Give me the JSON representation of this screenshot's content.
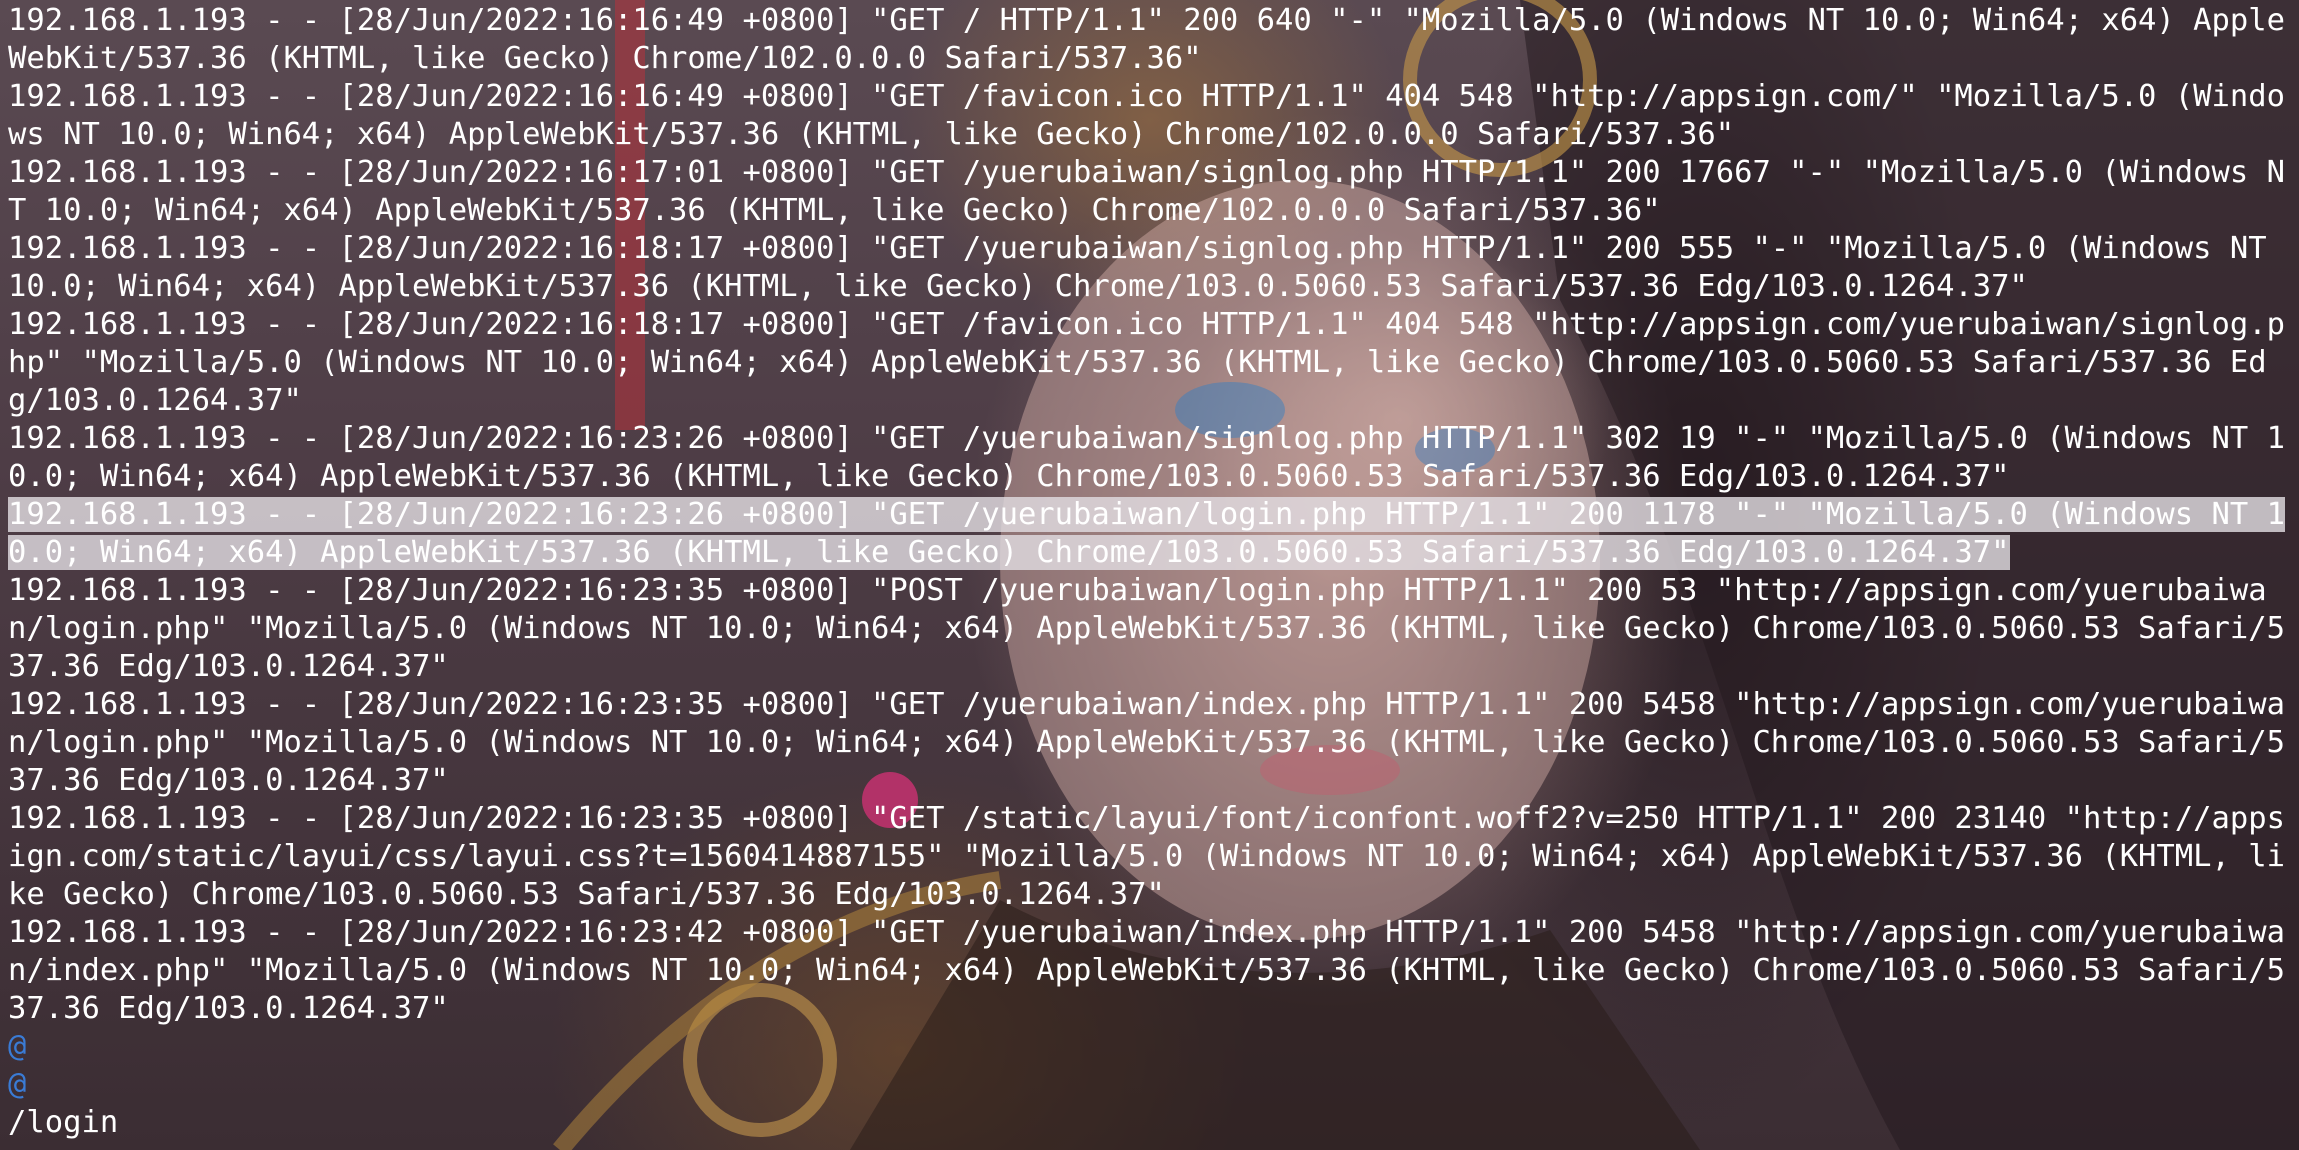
{
  "terminal": {
    "log_lines": [
      {
        "text": "192.168.1.193 - - [28/Jun/2022:16:16:49 +0800] \"GET / HTTP/1.1\" 200 640 \"-\" \"Mozilla/5.0 (Windows NT 10.0; Win64; x64) AppleWebKit/537.36 (KHTML, like Gecko) Chrome/102.0.0.0 Safari/537.36\"",
        "highlighted": false
      },
      {
        "text": "192.168.1.193 - - [28/Jun/2022:16:16:49 +0800] \"GET /favicon.ico HTTP/1.1\" 404 548 \"http://appsign.com/\" \"Mozilla/5.0 (Windows NT 10.0; Win64; x64) AppleWebKit/537.36 (KHTML, like Gecko) Chrome/102.0.0.0 Safari/537.36\"",
        "highlighted": false
      },
      {
        "text": "192.168.1.193 - - [28/Jun/2022:16:17:01 +0800] \"GET /yuerubaiwan/signlog.php HTTP/1.1\" 200 17667 \"-\" \"Mozilla/5.0 (Windows NT 10.0; Win64; x64) AppleWebKit/537.36 (KHTML, like Gecko) Chrome/102.0.0.0 Safari/537.36\"",
        "highlighted": false
      },
      {
        "text": "192.168.1.193 - - [28/Jun/2022:16:18:17 +0800] \"GET /yuerubaiwan/signlog.php HTTP/1.1\" 200 555 \"-\" \"Mozilla/5.0 (Windows NT 10.0; Win64; x64) AppleWebKit/537.36 (KHTML, like Gecko) Chrome/103.0.5060.53 Safari/537.36 Edg/103.0.1264.37\"",
        "highlighted": false
      },
      {
        "text": "192.168.1.193 - - [28/Jun/2022:16:18:17 +0800] \"GET /favicon.ico HTTP/1.1\" 404 548 \"http://appsign.com/yuerubaiwan/signlog.php\" \"Mozilla/5.0 (Windows NT 10.0; Win64; x64) AppleWebKit/537.36 (KHTML, like Gecko) Chrome/103.0.5060.53 Safari/537.36 Edg/103.0.1264.37\"",
        "highlighted": false
      },
      {
        "text": "192.168.1.193 - - [28/Jun/2022:16:23:26 +0800] \"GET /yuerubaiwan/signlog.php HTTP/1.1\" 302 19 \"-\" \"Mozilla/5.0 (Windows NT 10.0; Win64; x64) AppleWebKit/537.36 (KHTML, like Gecko) Chrome/103.0.5060.53 Safari/537.36 Edg/103.0.1264.37\"",
        "highlighted": false
      },
      {
        "text": "192.168.1.193 - - [28/Jun/2022:16:23:26 +0800] \"GET /yuerubaiwan/login.php HTTP/1.1\" 200 1178 \"-\" \"Mozilla/5.0 (Windows NT 10.0; Win64; x64) AppleWebKit/537.36 (KHTML, like Gecko) Chrome/103.0.5060.53 Safari/537.36 Edg/103.0.1264.37\"",
        "highlighted": true
      },
      {
        "text": "192.168.1.193 - - [28/Jun/2022:16:23:35 +0800] \"POST /yuerubaiwan/login.php HTTP/1.1\" 200 53 \"http://appsign.com/yuerubaiwan/login.php\" \"Mozilla/5.0 (Windows NT 10.0; Win64; x64) AppleWebKit/537.36 (KHTML, like Gecko) Chrome/103.0.5060.53 Safari/537.36 Edg/103.0.1264.37\"",
        "highlighted": false
      },
      {
        "text": "192.168.1.193 - - [28/Jun/2022:16:23:35 +0800] \"GET /yuerubaiwan/index.php HTTP/1.1\" 200 5458 \"http://appsign.com/yuerubaiwan/login.php\" \"Mozilla/5.0 (Windows NT 10.0; Win64; x64) AppleWebKit/537.36 (KHTML, like Gecko) Chrome/103.0.5060.53 Safari/537.36 Edg/103.0.1264.37\"",
        "highlighted": false
      },
      {
        "text": "192.168.1.193 - - [28/Jun/2022:16:23:35 +0800] \"GET /static/layui/font/iconfont.woff2?v=250 HTTP/1.1\" 200 23140 \"http://appsign.com/static/layui/css/layui.css?t=1560414887155\" \"Mozilla/5.0 (Windows NT 10.0; Win64; x64) AppleWebKit/537.36 (KHTML, like Gecko) Chrome/103.0.5060.53 Safari/537.36 Edg/103.0.1264.37\"",
        "highlighted": false
      },
      {
        "text": "192.168.1.193 - - [28/Jun/2022:16:23:42 +0800] \"GET /yuerubaiwan/index.php HTTP/1.1\" 200 5458 \"http://appsign.com/yuerubaiwan/index.php\" \"Mozilla/5.0 (Windows NT 10.0; Win64; x64) AppleWebKit/537.36 (KHTML, like Gecko) Chrome/103.0.5060.53 Safari/537.36 Edg/103.0.1264.37\"",
        "highlighted": false
      }
    ],
    "empty_line_markers": [
      "@",
      "@"
    ],
    "search_command": "/login",
    "colors": {
      "text": "#ffffff",
      "marker": "#3a7bd5",
      "highlight": "#e1dce1"
    }
  }
}
